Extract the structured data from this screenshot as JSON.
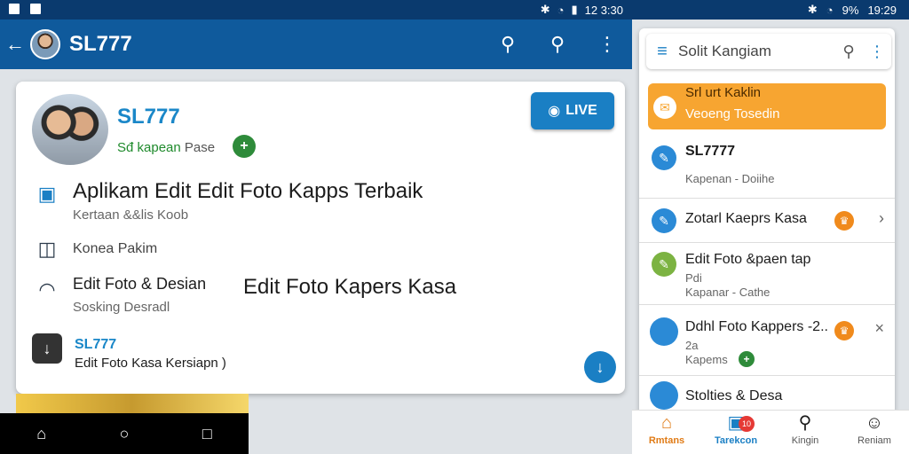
{
  "status_left": {
    "time": "12 3:30"
  },
  "status_right": {
    "battery": "9%",
    "time": "19:29"
  },
  "appbar": {
    "title": "SL777"
  },
  "profile": {
    "name": "SL777",
    "subtitle_green": "Sđ kapean",
    "subtitle_rest": " Pase",
    "plus": "+",
    "live_button": "LIVE"
  },
  "rows": {
    "r1": {
      "title": "Aplikam Edit Edit Foto Kapps Terbaik",
      "sub": "Kertaan &&lis Koob"
    },
    "r2": {
      "title": "Konea Pakim"
    },
    "r3": {
      "title": "Edit Foto & Desian",
      "sub": "Sosking Desradl",
      "big": "Edit Foto Kapers Kasa"
    },
    "r4": {
      "title": "SL777",
      "sub": "Edit Foto Kasa Kersiapn )"
    }
  },
  "right_panel": {
    "search_value": "Solit Kangiam",
    "promo": {
      "title": "Srl urt Kaklin",
      "sub": "Veoeng Tosedin"
    },
    "items": [
      {
        "title": "SL7777",
        "sub": "Kapenan - Doiihe"
      },
      {
        "title": "Zotarl Kaeprs Kasa",
        "badge": ""
      },
      {
        "title": "Edit Foto &paen tap",
        "sub": "Pdi",
        "sub2": "Kapanar - Cathe"
      },
      {
        "title": "Ddhl Foto Kappers -2..",
        "sub": "2a",
        "sub2": "Kapems"
      },
      {
        "title": "Stolties & Desa"
      }
    ]
  },
  "bottom_nav": {
    "home": "Rmtans",
    "tv": "Tarekcon",
    "notif_count": "10",
    "search": "Kingin",
    "profile": "Reniam"
  },
  "colors": {
    "appbar": "#0f5a9c",
    "accent": "#1a7fc4",
    "promo": "#f7a531"
  }
}
